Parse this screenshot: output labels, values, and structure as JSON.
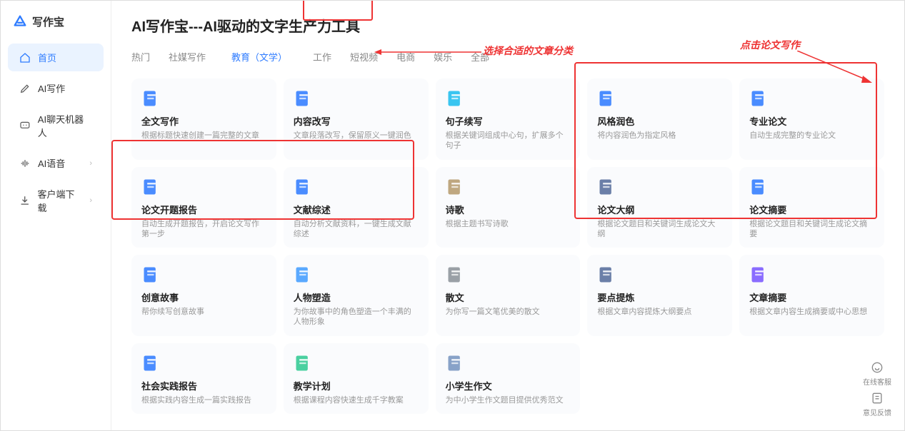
{
  "logo": {
    "text": "写作宝"
  },
  "sidebar": {
    "items": [
      {
        "label": "首页",
        "icon": "home"
      },
      {
        "label": "AI写作",
        "icon": "pencil"
      },
      {
        "label": "AI聊天机器人",
        "icon": "chat"
      },
      {
        "label": "AI语音",
        "icon": "audio"
      },
      {
        "label": "客户端下载",
        "icon": "download"
      }
    ]
  },
  "header": {
    "title": "AI写作宝---AI驱动的文字生产力工具"
  },
  "tabs": [
    {
      "label": "热门"
    },
    {
      "label": "社媒写作"
    },
    {
      "label": "教育（文学）"
    },
    {
      "label": "工作"
    },
    {
      "label": "短视频"
    },
    {
      "label": "电商"
    },
    {
      "label": "娱乐"
    },
    {
      "label": "全部"
    }
  ],
  "annotations": {
    "left": "选择合适的文章分类",
    "right": "点击论文写作"
  },
  "cards": [
    {
      "title": "全文写作",
      "desc": "根据标题快速创建一篇完整的文章",
      "color": "#4a8cff"
    },
    {
      "title": "内容改写",
      "desc": "文章段落改写，保留原义一键润色",
      "color": "#4a8cff"
    },
    {
      "title": "句子续写",
      "desc": "根据关键词组成中心句，扩展多个句子",
      "color": "#39c5f0"
    },
    {
      "title": "风格润色",
      "desc": "将内容润色为指定风格",
      "color": "#4a8cff"
    },
    {
      "title": "专业论文",
      "desc": "自动生成完整的专业论文",
      "color": "#4a8cff"
    },
    {
      "title": "论文开题报告",
      "desc": "自动生成开题报告，开启论文写作第一步",
      "color": "#4a8cff"
    },
    {
      "title": "文献综述",
      "desc": "自动分析文献资料，一键生成文献综述",
      "color": "#4a8cff"
    },
    {
      "title": "诗歌",
      "desc": "根据主题书写诗歌",
      "color": "#bfa780"
    },
    {
      "title": "论文大纲",
      "desc": "根据论文题目和关键词生成论文大纲",
      "color": "#6b7fa8"
    },
    {
      "title": "论文摘要",
      "desc": "根据论文题目和关键词生成论文摘要",
      "color": "#4a8cff"
    },
    {
      "title": "创意故事",
      "desc": "帮你续写创意故事",
      "color": "#4a8cff"
    },
    {
      "title": "人物塑造",
      "desc": "为你故事中的角色塑造一个丰满的人物形象",
      "color": "#5aa9ff"
    },
    {
      "title": "散文",
      "desc": "为你写一篇文笔优美的散文",
      "color": "#9aa0a6"
    },
    {
      "title": "要点提炼",
      "desc": "根据文章内容提炼大纲要点",
      "color": "#6b7fa8"
    },
    {
      "title": "文章摘要",
      "desc": "根据文章内容生成摘要或中心思想",
      "color": "#8a6cff"
    },
    {
      "title": "社会实践报告",
      "desc": "根据实践内容生成一篇实践报告",
      "color": "#4a8cff"
    },
    {
      "title": "教学计划",
      "desc": "根据课程内容快速生成千字教案",
      "color": "#4ad0a0"
    },
    {
      "title": "小学生作文",
      "desc": "为中小学生作文题目提供优秀范文",
      "color": "#88a2c8"
    }
  ],
  "float": {
    "help": "在线客服",
    "feedback": "意见反馈"
  }
}
